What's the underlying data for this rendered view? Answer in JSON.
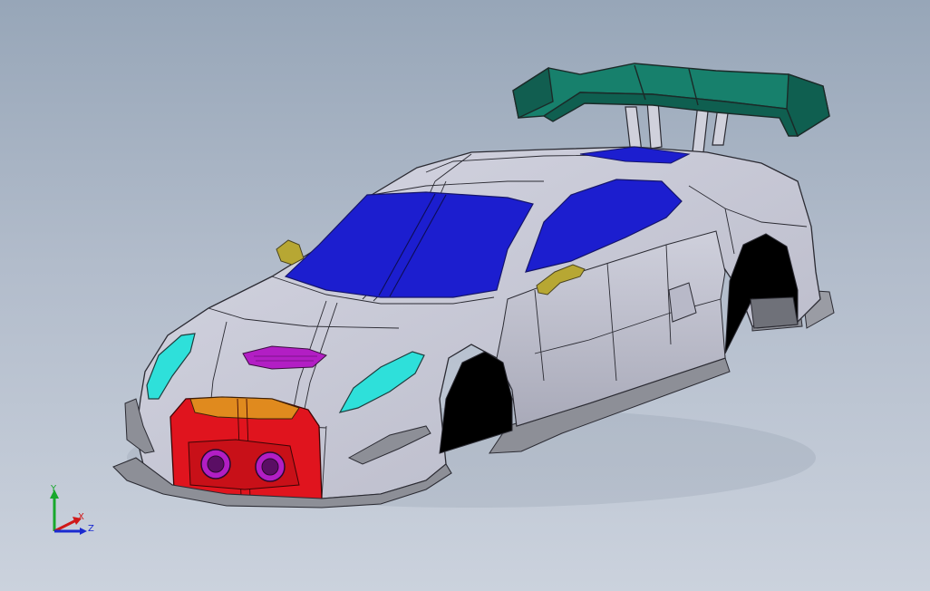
{
  "viewport": {
    "background_top": "#97a6b8",
    "background_bottom": "#cbd2dd"
  },
  "model": {
    "body_color": "#c9cad8",
    "glass_color": "#1c1ecf",
    "headlight_color": "#2ee0da",
    "grille_color": "#e0141e",
    "signal_color": "#e08a1e",
    "vent_color": "#b21ec4",
    "wing_color": "#17806c",
    "mirror_color": "#b7a733",
    "aero_color": "#8d8f97"
  },
  "triad": {
    "y_label": "Y",
    "x_label": "X",
    "z_label": "Z",
    "y_color": "#18a82c",
    "x_color": "#d01818",
    "z_color": "#1a2ad0"
  }
}
